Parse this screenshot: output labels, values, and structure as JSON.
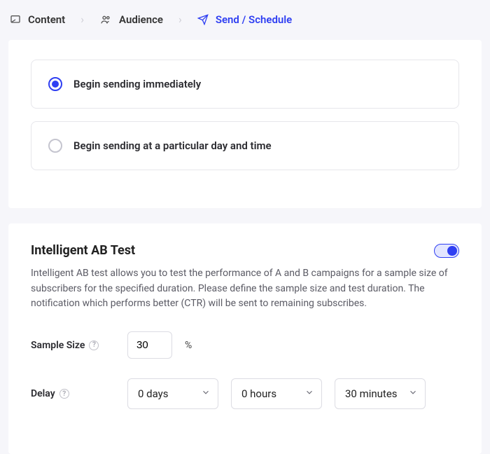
{
  "breadcrumb": {
    "steps": [
      {
        "label": "Content",
        "icon": "content-icon"
      },
      {
        "label": "Audience",
        "icon": "audience-icon"
      },
      {
        "label": "Send / Schedule",
        "icon": "send-icon"
      }
    ],
    "active_index": 2
  },
  "sending_options": {
    "selected_index": 0,
    "options": [
      {
        "label": "Begin sending immediately"
      },
      {
        "label": "Begin sending at a particular day and time"
      }
    ]
  },
  "ab_test": {
    "title": "Intelligent AB Test",
    "enabled": true,
    "description": "Intelligent AB test allows you to test the performance of A and B campaigns for a sample size of subscribers for the specified duration. Please define the sample size and test duration. The notification which performs better (CTR) will be sent to remaining subscribes.",
    "sample_size": {
      "label": "Sample Size",
      "value": "30",
      "unit": "%"
    },
    "delay": {
      "label": "Delay",
      "days": {
        "value": "0 days"
      },
      "hours": {
        "value": "0 hours"
      },
      "minutes": {
        "value": "30 minutes"
      }
    }
  }
}
